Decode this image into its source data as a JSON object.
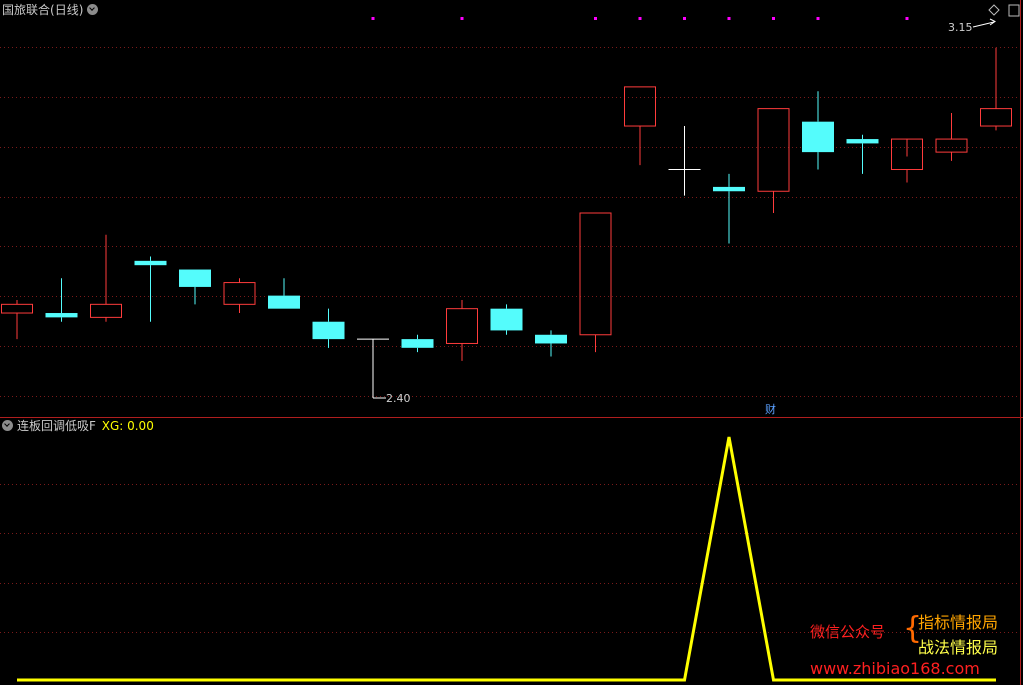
{
  "header": {
    "title": "国旅联合",
    "period": "(日线)"
  },
  "indicator": {
    "name": "连板回调低吸F",
    "value_label": "XG: 0.00"
  },
  "annotations": {
    "high_label": "3.15",
    "low_label": "2.40",
    "finance_marker": "财"
  },
  "watermark": {
    "wechat_label": "微信公众号",
    "account_1": "指标情报局",
    "account_2": "战法情报局",
    "url": "www.zhibiao168.com"
  },
  "colors": {
    "background": "#000000",
    "up": "#ff3c3c",
    "down": "#54fcfc",
    "neutral": "#ffffff",
    "indicator_line": "#ffff00",
    "grid": "#7a1a1a",
    "signal_dot": "#ff00ff"
  },
  "chart_data": [
    {
      "type": "candlestick",
      "title": "国旅联合 (日线)",
      "grid": true,
      "y_range": [
        2.34,
        3.2
      ],
      "candles": [
        {
          "o": 2.54,
          "h": 2.57,
          "l": 2.48,
          "c": 2.56
        },
        {
          "o": 2.54,
          "h": 2.62,
          "l": 2.52,
          "c": 2.53
        },
        {
          "o": 2.53,
          "h": 2.72,
          "l": 2.52,
          "c": 2.56
        },
        {
          "o": 2.66,
          "h": 2.67,
          "l": 2.52,
          "c": 2.65
        },
        {
          "o": 2.64,
          "h": 2.64,
          "l": 2.56,
          "c": 2.6
        },
        {
          "o": 2.56,
          "h": 2.62,
          "l": 2.54,
          "c": 2.61
        },
        {
          "o": 2.58,
          "h": 2.62,
          "l": 2.55,
          "c": 2.55
        },
        {
          "o": 2.52,
          "h": 2.55,
          "l": 2.46,
          "c": 2.48
        },
        {
          "o": 2.48,
          "h": 2.48,
          "l": 2.4,
          "c": 2.48
        },
        {
          "o": 2.48,
          "h": 2.49,
          "l": 2.45,
          "c": 2.46
        },
        {
          "o": 2.47,
          "h": 2.57,
          "l": 2.43,
          "c": 2.55
        },
        {
          "o": 2.55,
          "h": 2.56,
          "l": 2.49,
          "c": 2.5
        },
        {
          "o": 2.49,
          "h": 2.5,
          "l": 2.44,
          "c": 2.47
        },
        {
          "o": 2.49,
          "h": 2.77,
          "l": 2.45,
          "c": 2.77
        },
        {
          "o": 2.97,
          "h": 3.06,
          "l": 2.88,
          "c": 3.06
        },
        {
          "o": 2.87,
          "h": 2.97,
          "l": 2.81,
          "c": 2.87
        },
        {
          "o": 2.83,
          "h": 2.86,
          "l": 2.7,
          "c": 2.82
        },
        {
          "o": 2.82,
          "h": 3.01,
          "l": 2.77,
          "c": 3.01
        },
        {
          "o": 2.98,
          "h": 3.05,
          "l": 2.87,
          "c": 2.91
        },
        {
          "o": 2.94,
          "h": 2.95,
          "l": 2.86,
          "c": 2.93
        },
        {
          "o": 2.87,
          "h": 2.9,
          "l": 2.84,
          "c": 2.94
        },
        {
          "o": 2.91,
          "h": 3.0,
          "l": 2.89,
          "c": 2.94
        },
        {
          "o": 2.97,
          "h": 3.15,
          "l": 2.96,
          "c": 3.01
        }
      ],
      "signal_dots_at": [
        8,
        10,
        13,
        14,
        15,
        16,
        17,
        18,
        20
      ]
    },
    {
      "type": "line",
      "series": [
        {
          "name": "XG",
          "values": [
            0,
            0,
            0,
            0,
            0,
            0,
            0,
            0,
            0,
            0,
            0,
            0,
            0,
            0,
            0,
            0,
            1,
            0,
            0,
            0,
            0,
            0,
            0
          ]
        }
      ],
      "ylim": [
        0,
        1
      ]
    }
  ]
}
